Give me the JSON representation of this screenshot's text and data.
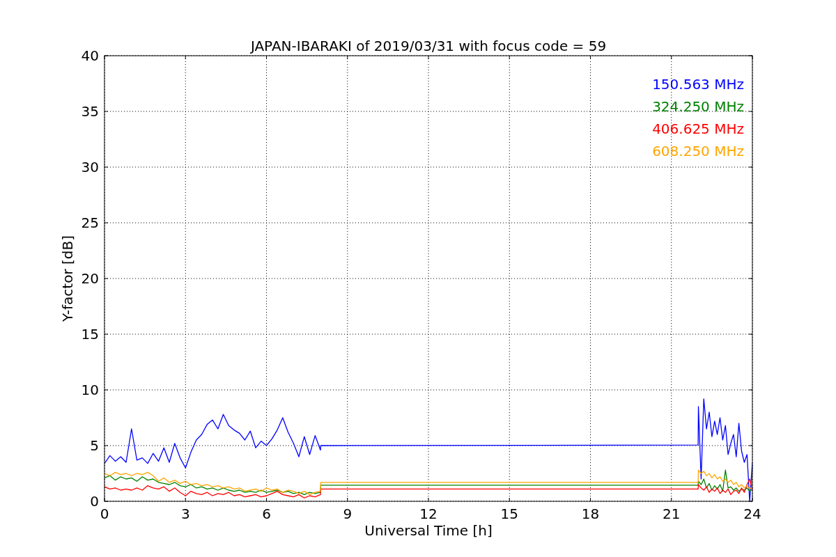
{
  "figure": {
    "chart_data": {
      "type": "line",
      "title": "JAPAN-IBARAKI of 2019/03/31 with focus code = 59",
      "xlabel": "Universal Time [h]",
      "ylabel": "Y-factor [dB]",
      "x": [
        0,
        0.2,
        0.4,
        0.6,
        0.8,
        1.0,
        1.2,
        1.4,
        1.6,
        1.8,
        2.0,
        2.2,
        2.4,
        2.6,
        2.8,
        3.0,
        3.2,
        3.4,
        3.6,
        3.8,
        4.0,
        4.2,
        4.4,
        4.6,
        4.8,
        5.0,
        5.2,
        5.4,
        5.6,
        5.8,
        6.0,
        6.2,
        6.4,
        6.6,
        6.8,
        7.0,
        7.2,
        7.4,
        7.6,
        7.8,
        8.0,
        8.01,
        21.99,
        22.0,
        22.1,
        22.2,
        22.3,
        22.4,
        22.5,
        22.6,
        22.7,
        22.8,
        22.9,
        23.0,
        23.1,
        23.2,
        23.3,
        23.4,
        23.5,
        23.6,
        23.7,
        23.8,
        23.9,
        24.0
      ],
      "series": [
        {
          "name": "150.563 MHz",
          "color": "#0000ff",
          "values": [
            3.4,
            4.1,
            3.6,
            4.0,
            3.5,
            6.5,
            3.7,
            3.9,
            3.4,
            4.3,
            3.6,
            4.8,
            3.5,
            5.2,
            3.9,
            3.0,
            4.4,
            5.5,
            6.0,
            6.9,
            7.3,
            6.5,
            7.8,
            6.8,
            6.4,
            6.1,
            5.5,
            6.3,
            4.8,
            5.4,
            5.0,
            5.6,
            6.4,
            7.5,
            6.2,
            5.2,
            4.0,
            5.8,
            4.2,
            5.9,
            4.6,
            5.0,
            5.05,
            8.5,
            2.0,
            9.2,
            6.5,
            8.0,
            5.8,
            7.2,
            6.0,
            7.5,
            5.5,
            6.8,
            4.2,
            5.2,
            6.0,
            4.0,
            7.0,
            4.5,
            3.5,
            4.2,
            0.0,
            3.5
          ]
        },
        {
          "name": "324.250 MHz",
          "color": "#008000",
          "values": [
            2.1,
            2.3,
            1.9,
            2.2,
            2.0,
            2.1,
            1.8,
            2.2,
            1.9,
            2.0,
            1.7,
            1.6,
            1.5,
            1.7,
            1.4,
            1.3,
            1.5,
            1.2,
            1.3,
            1.1,
            1.2,
            1.0,
            1.2,
            1.0,
            0.9,
            1.0,
            0.8,
            0.9,
            0.8,
            1.0,
            0.8,
            0.9,
            1.0,
            0.8,
            0.9,
            0.7,
            0.8,
            0.6,
            0.8,
            0.7,
            0.8,
            1.45,
            1.45,
            1.8,
            1.5,
            2.0,
            1.2,
            1.6,
            1.0,
            1.4,
            1.1,
            1.5,
            0.9,
            2.8,
            1.2,
            1.3,
            1.0,
            1.2,
            0.9,
            1.1,
            1.0,
            1.2,
            0.9,
            1.1
          ]
        },
        {
          "name": "406.625 MHz",
          "color": "#ff0000",
          "values": [
            1.3,
            1.1,
            1.2,
            1.0,
            1.1,
            1.0,
            1.2,
            1.0,
            1.4,
            1.2,
            1.1,
            1.3,
            0.9,
            1.2,
            0.8,
            0.5,
            0.9,
            0.7,
            0.6,
            0.8,
            0.5,
            0.7,
            0.6,
            0.8,
            0.5,
            0.6,
            0.4,
            0.5,
            0.6,
            0.4,
            0.5,
            0.7,
            0.9,
            0.6,
            0.5,
            0.4,
            0.6,
            0.3,
            0.5,
            0.4,
            0.6,
            1.1,
            1.1,
            1.5,
            1.2,
            1.0,
            1.3,
            0.8,
            1.1,
            0.9,
            1.2,
            0.7,
            1.0,
            0.8,
            1.1,
            0.6,
            0.9,
            1.0,
            0.7,
            1.2,
            0.8,
            1.5,
            2.0,
            1.0
          ]
        },
        {
          "name": "608.250 MHz",
          "color": "#ffa500",
          "values": [
            2.5,
            2.3,
            2.6,
            2.4,
            2.5,
            2.3,
            2.5,
            2.4,
            2.6,
            2.3,
            1.8,
            2.1,
            1.7,
            1.9,
            1.6,
            1.8,
            1.5,
            1.6,
            1.4,
            1.5,
            1.3,
            1.4,
            1.2,
            1.3,
            1.1,
            1.2,
            0.9,
            1.0,
            1.1,
            0.9,
            1.2,
            1.0,
            1.1,
            0.8,
            1.0,
            0.9,
            0.7,
            0.9,
            0.6,
            0.8,
            0.9,
            1.7,
            1.7,
            2.8,
            2.5,
            2.7,
            2.3,
            2.5,
            2.1,
            2.4,
            2.0,
            2.2,
            1.8,
            2.0,
            1.7,
            1.9,
            1.5,
            1.7,
            1.3,
            1.5,
            1.2,
            1.4,
            1.1,
            1.3
          ]
        }
      ],
      "grid": true,
      "xlim": [
        0,
        24
      ],
      "ylim": [
        0,
        40
      ],
      "xticks": [
        0,
        3,
        6,
        9,
        12,
        15,
        18,
        21,
        24
      ],
      "yticks": [
        0,
        5,
        10,
        15,
        20,
        25,
        30,
        35,
        40
      ]
    }
  }
}
